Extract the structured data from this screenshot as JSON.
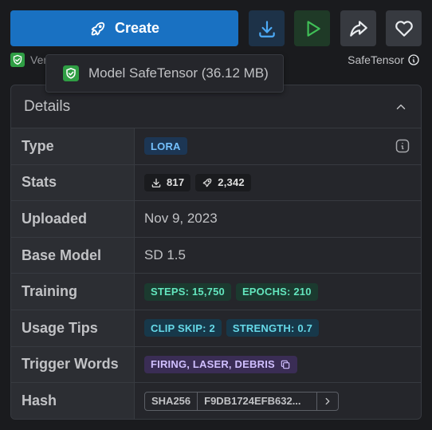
{
  "actions": {
    "create_label": "Create"
  },
  "file": {
    "version_text": "Ver",
    "format_label": "SafeTensor"
  },
  "tooltip": {
    "text": "Model SafeTensor (36.12 MB)"
  },
  "details": {
    "title": "Details",
    "rows": {
      "type": {
        "label": "Type",
        "badge": "LORA"
      },
      "stats": {
        "label": "Stats",
        "downloads": "817",
        "generations": "2,342"
      },
      "uploaded": {
        "label": "Uploaded",
        "value": "Nov 9, 2023"
      },
      "base_model": {
        "label": "Base Model",
        "value": "SD 1.5"
      },
      "training": {
        "label": "Training",
        "steps": "STEPS: 15,750",
        "epochs": "EPOCHS: 210"
      },
      "usage_tips": {
        "label": "Usage Tips",
        "clip_skip": "CLIP SKIP: 2",
        "strength": "STRENGTH: 0.7"
      },
      "trigger_words": {
        "label": "Trigger Words",
        "words": "FIRING, LASER, DEBRIS"
      },
      "hash": {
        "label": "Hash",
        "algo": "SHA256",
        "code": "F9DB1724EFB632..."
      }
    }
  },
  "colors": {
    "primary": "#1971c2",
    "download_bg": "#1d3248",
    "play_bg": "#1f3a27",
    "neutral_bg": "#373a40",
    "safe_badge": "#2f9e44"
  },
  "icons": {
    "create": "rocket-icon",
    "download": "download-icon",
    "play": "play-icon",
    "share": "share-icon",
    "like": "heart-icon",
    "shield": "shield-check-icon",
    "info": "info-icon",
    "collapse": "chevron-up-icon",
    "copy": "copy-icon",
    "next": "chevron-right-icon"
  }
}
